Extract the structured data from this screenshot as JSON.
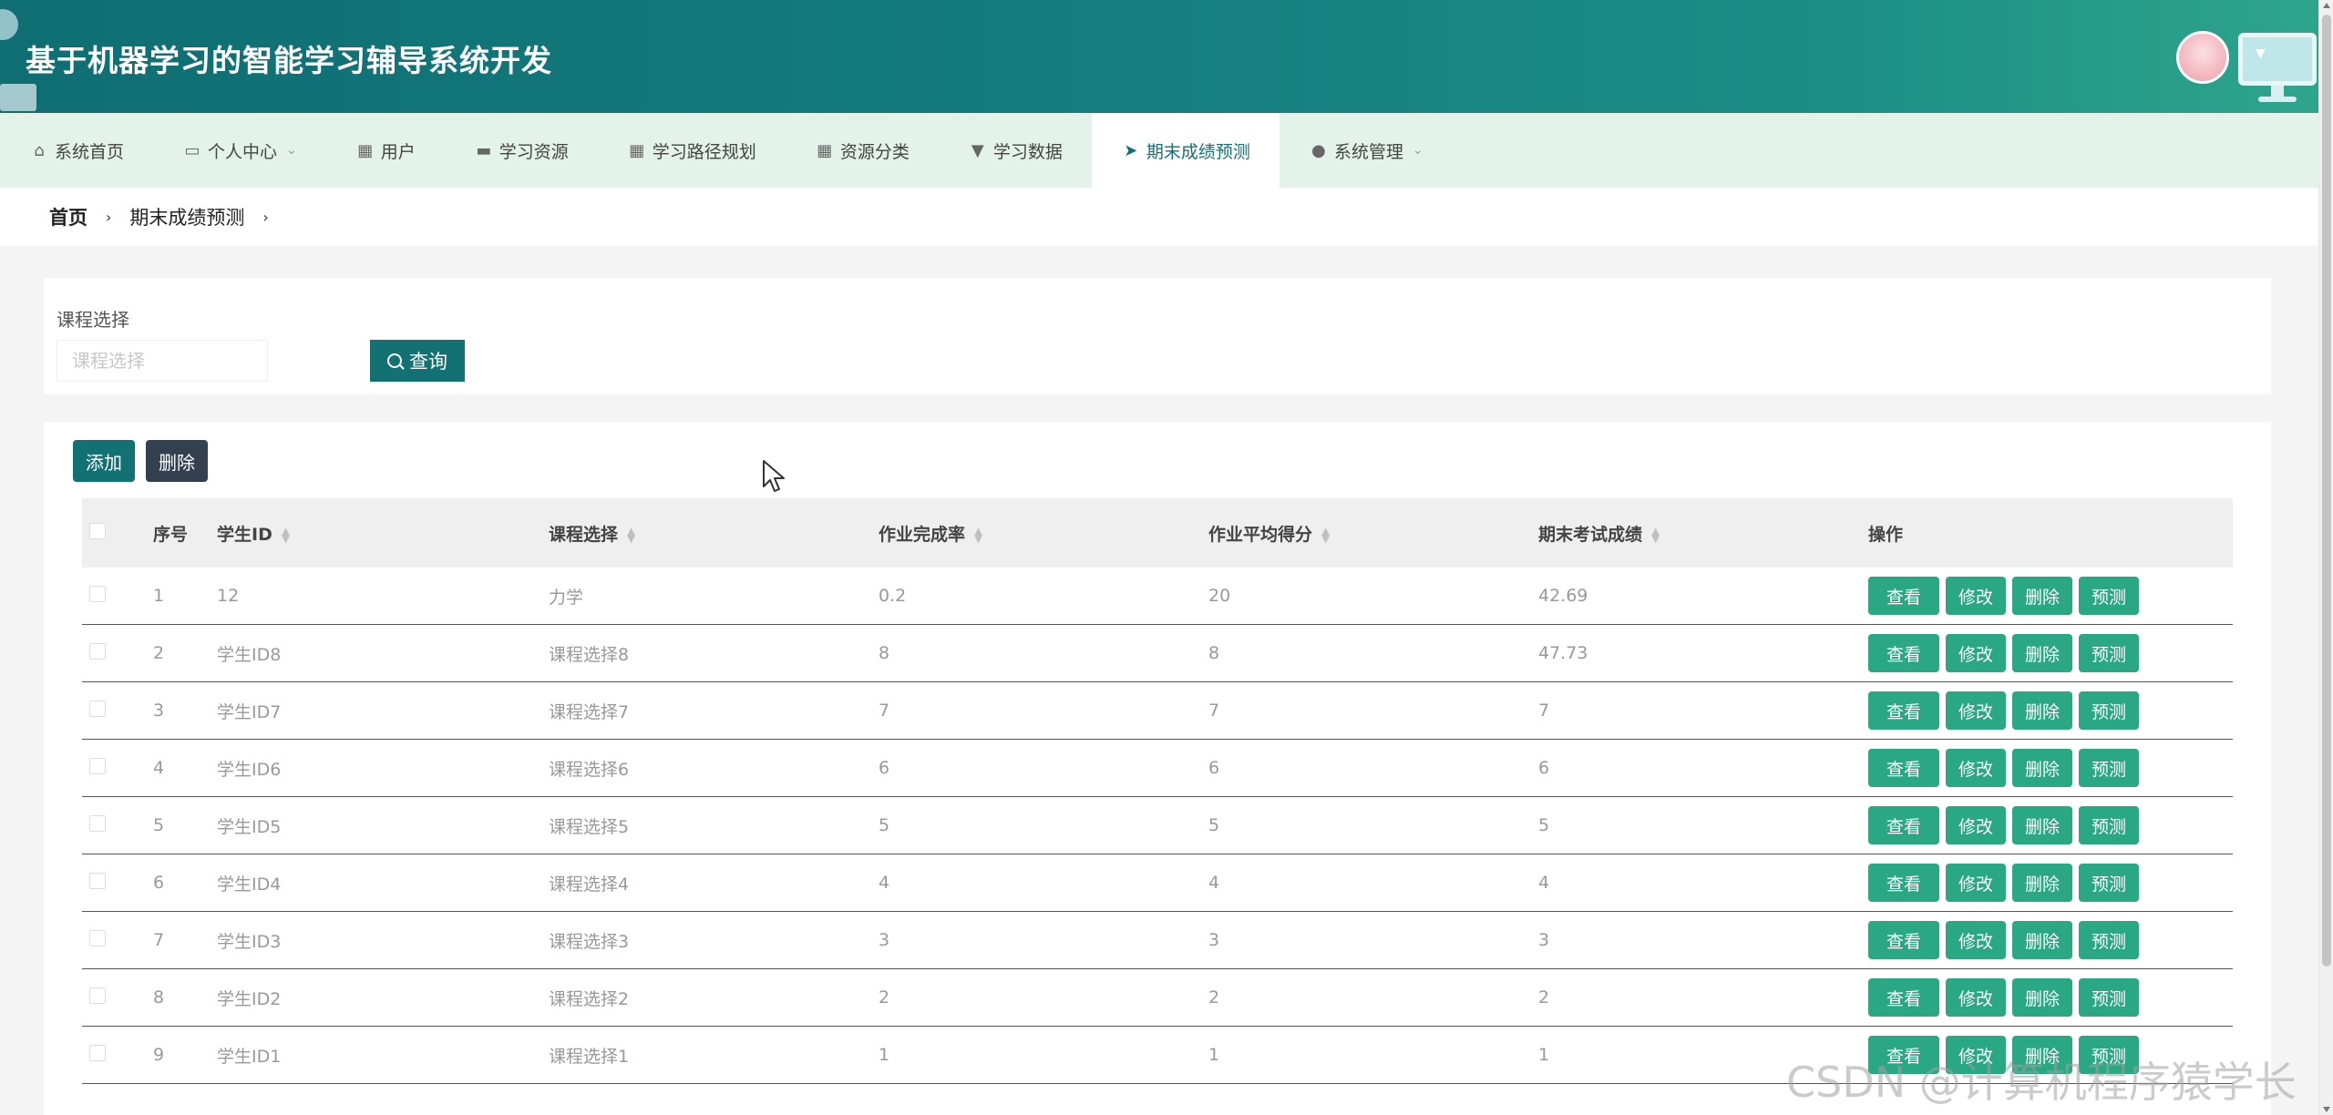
{
  "header": {
    "title": "基于机器学习的智能学习辅导系统开发"
  },
  "nav": {
    "items": [
      {
        "label": "系统首页",
        "icon": "home-icon",
        "glyph": "⌂",
        "dropdown": false,
        "active": false
      },
      {
        "label": "个人中心",
        "icon": "id-card-icon",
        "glyph": "▭",
        "dropdown": true,
        "active": false
      },
      {
        "label": "用户",
        "icon": "grid-icon",
        "glyph": "▦",
        "dropdown": false,
        "active": false
      },
      {
        "label": "学习资源",
        "icon": "drive-icon",
        "glyph": "▬",
        "dropdown": false,
        "active": false
      },
      {
        "label": "学习路径规划",
        "icon": "grid-icon",
        "glyph": "▦",
        "dropdown": false,
        "active": false
      },
      {
        "label": "资源分类",
        "icon": "grid-icon",
        "glyph": "▦",
        "dropdown": false,
        "active": false
      },
      {
        "label": "学习数据",
        "icon": "stamp-icon",
        "glyph": "▼",
        "dropdown": false,
        "active": false
      },
      {
        "label": "期末成绩预测",
        "icon": "paper-plane-icon",
        "glyph": "➤",
        "dropdown": false,
        "active": true
      },
      {
        "label": "系统管理",
        "icon": "user-icon",
        "glyph": "●",
        "dropdown": true,
        "active": false
      }
    ]
  },
  "breadcrumb": {
    "home": "首页",
    "current": "期末成绩预测",
    "sep": "›"
  },
  "search": {
    "label": "课程选择",
    "placeholder": "课程选择",
    "query_label": "查询"
  },
  "actions": {
    "add_label": "添加",
    "delete_label": "删除"
  },
  "table": {
    "headers": {
      "no": "序号",
      "student_id": "学生ID",
      "course": "课程选择",
      "hw_rate": "作业完成率",
      "hw_avg": "作业平均得分",
      "final": "期末考试成绩",
      "ops": "操作"
    },
    "op_labels": {
      "view": "查看",
      "edit": "修改",
      "delete": "删除",
      "predict": "预测"
    },
    "rows": [
      {
        "no": "1",
        "student_id": "12",
        "course": "力学",
        "hw_rate": "0.2",
        "hw_avg": "20",
        "final": "42.69"
      },
      {
        "no": "2",
        "student_id": "学生ID8",
        "course": "课程选择8",
        "hw_rate": "8",
        "hw_avg": "8",
        "final": "47.73"
      },
      {
        "no": "3",
        "student_id": "学生ID7",
        "course": "课程选择7",
        "hw_rate": "7",
        "hw_avg": "7",
        "final": "7"
      },
      {
        "no": "4",
        "student_id": "学生ID6",
        "course": "课程选择6",
        "hw_rate": "6",
        "hw_avg": "6",
        "final": "6"
      },
      {
        "no": "5",
        "student_id": "学生ID5",
        "course": "课程选择5",
        "hw_rate": "5",
        "hw_avg": "5",
        "final": "5"
      },
      {
        "no": "6",
        "student_id": "学生ID4",
        "course": "课程选择4",
        "hw_rate": "4",
        "hw_avg": "4",
        "final": "4"
      },
      {
        "no": "7",
        "student_id": "学生ID3",
        "course": "课程选择3",
        "hw_rate": "3",
        "hw_avg": "3",
        "final": "3"
      },
      {
        "no": "8",
        "student_id": "学生ID2",
        "course": "课程选择2",
        "hw_rate": "2",
        "hw_avg": "2",
        "final": "2"
      },
      {
        "no": "9",
        "student_id": "学生ID1",
        "course": "课程选择1",
        "hw_rate": "1",
        "hw_avg": "1",
        "final": "1"
      }
    ]
  },
  "watermark": "CSDN @计算机程序猿学长",
  "colors": {
    "primary": "#127173",
    "op_button": "#2aa783",
    "delete_button": "#33404f",
    "nav_bg": "#e4f3ea"
  }
}
